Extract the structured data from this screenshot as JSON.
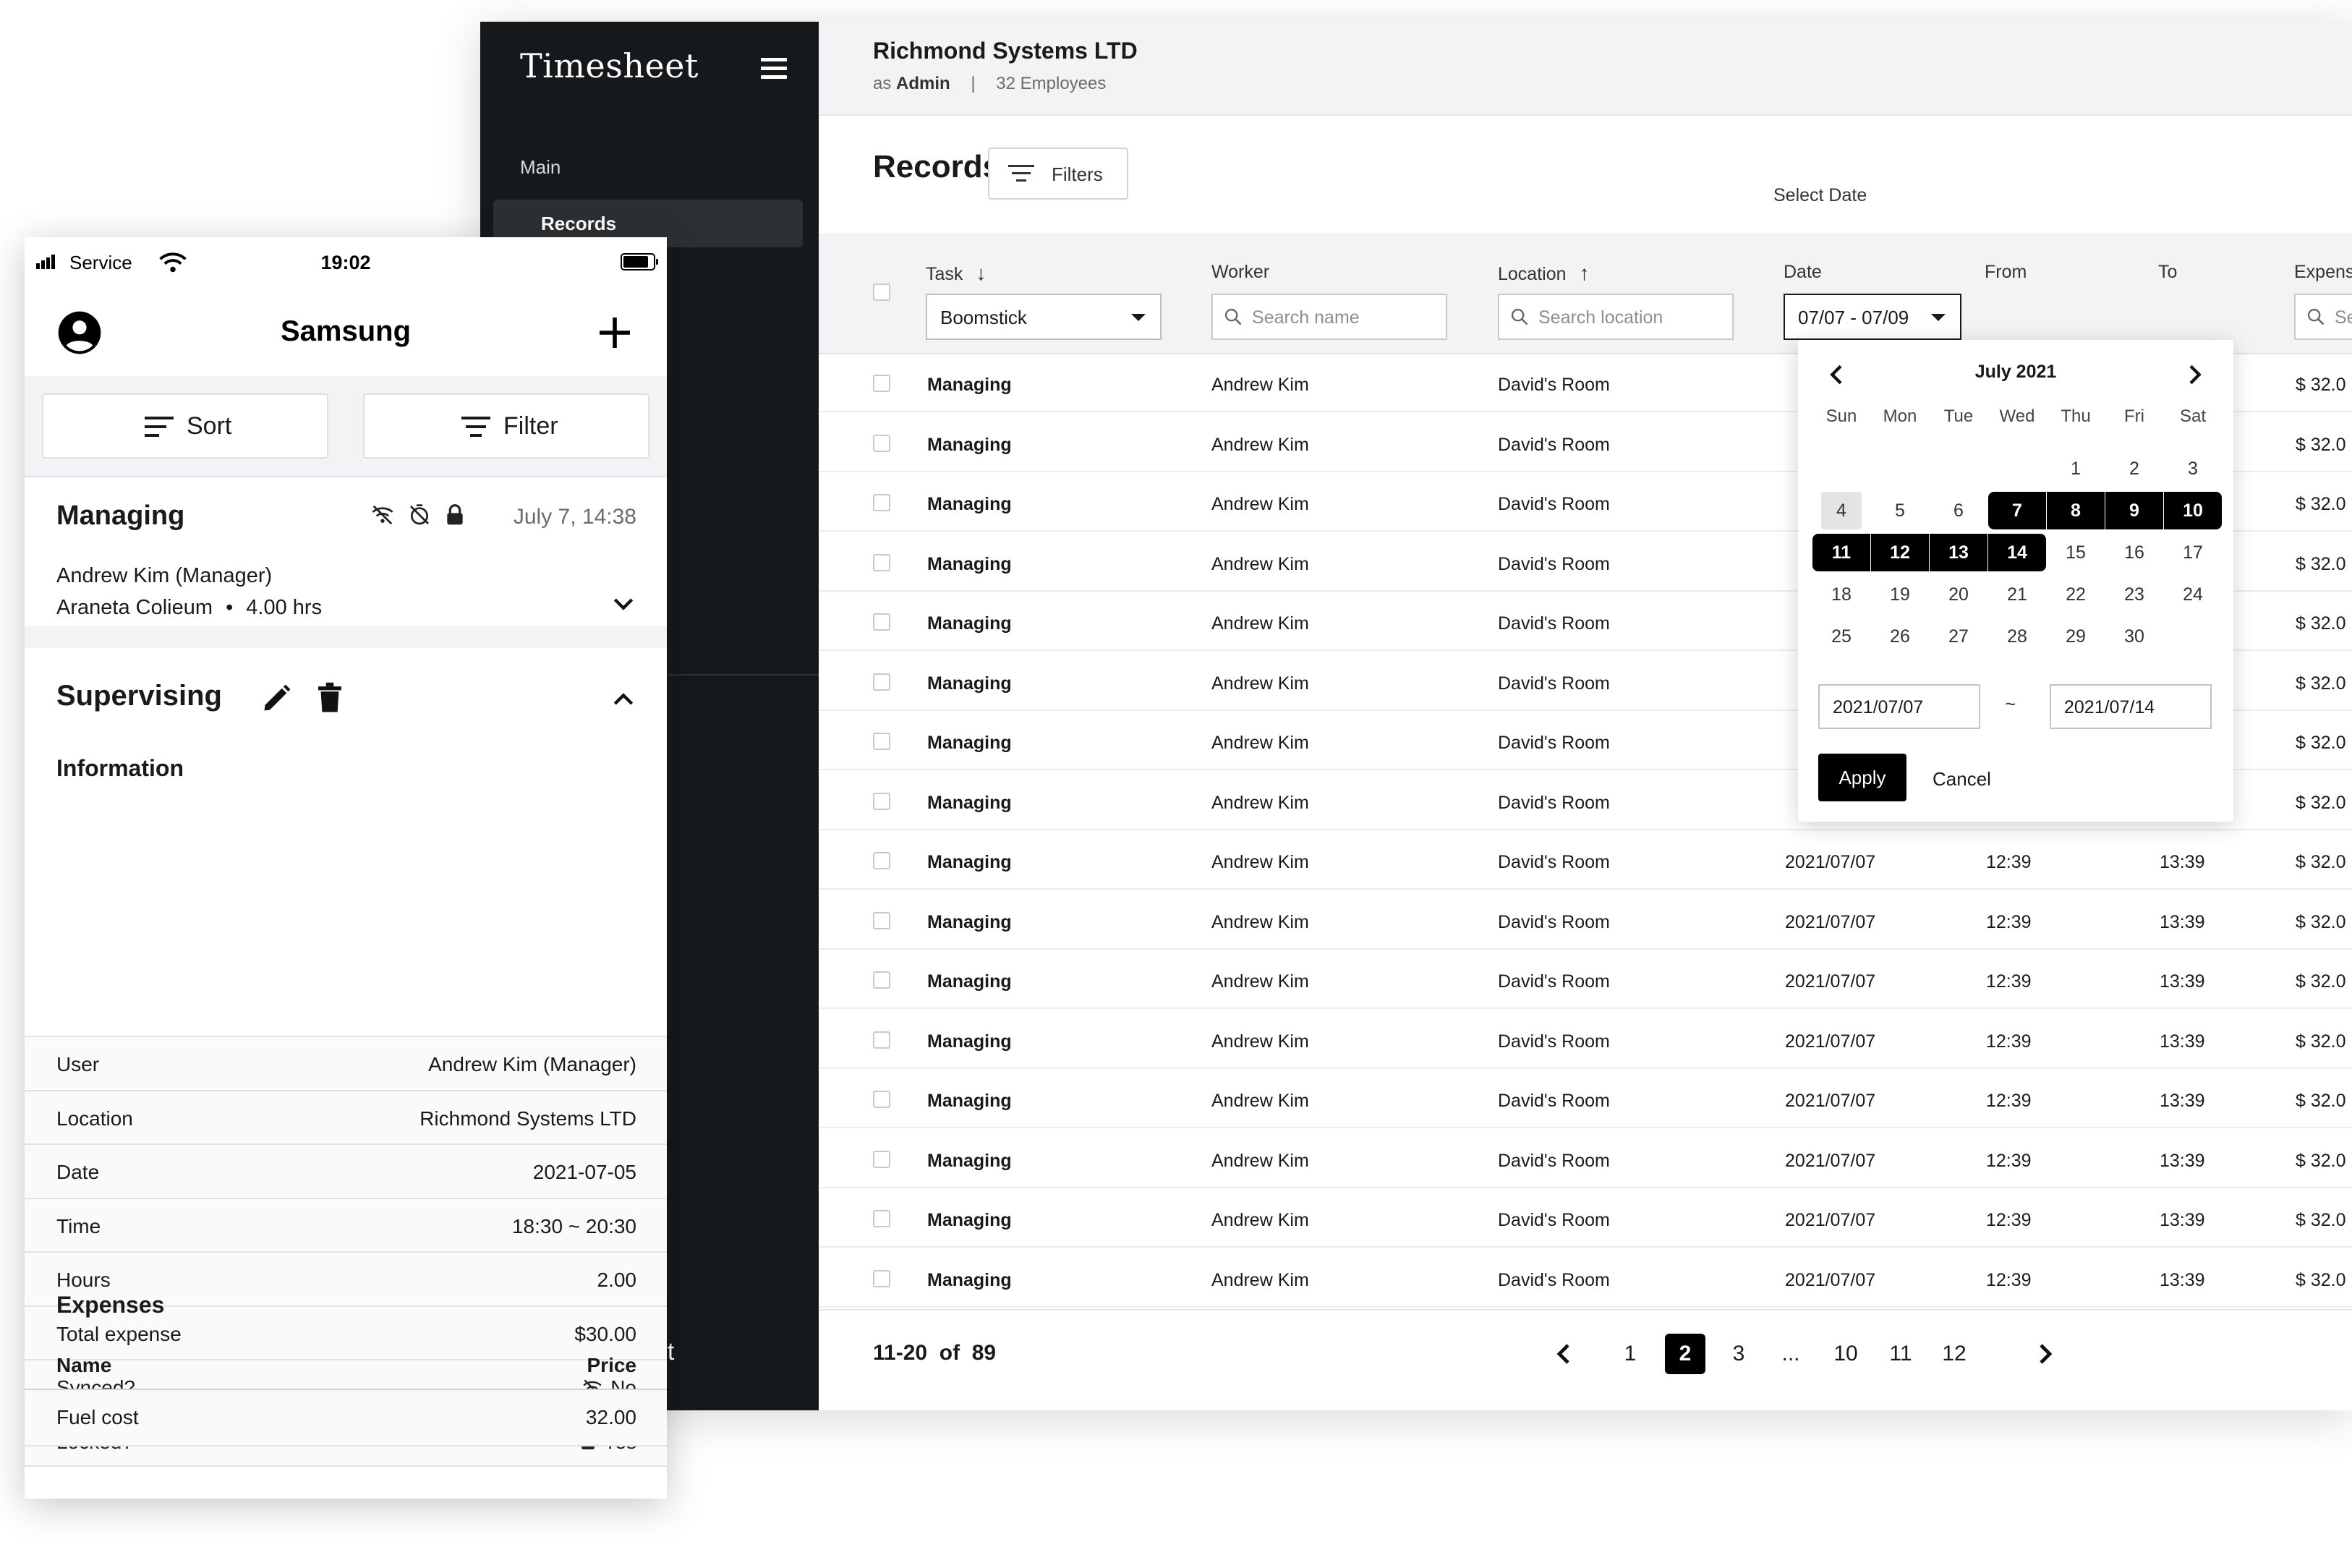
{
  "desktop": {
    "sidebar": {
      "brand": "Timesheet",
      "section_label": "Main",
      "active_item": "Records",
      "logout_partial": "ut"
    },
    "topbar": {
      "company": "Richmond Systems LTD",
      "role_prefix": "as",
      "role": "Admin",
      "separator": "|",
      "employees": "32 Employees"
    },
    "page_title": "Records",
    "filters_label": "Filters",
    "select_date_label": "Select Date",
    "columns": {
      "task": "Task",
      "worker": "Worker",
      "location": "Location",
      "date": "Date",
      "from": "From",
      "to": "To",
      "expense": "Expens"
    },
    "filters": {
      "task_value": "Boomstick",
      "worker_placeholder": "Search name",
      "location_placeholder": "Search location",
      "date_value": "07/07 - 07/09",
      "expense_placeholder": "Se"
    },
    "rows": [
      {
        "task": "Managing",
        "worker": "Andrew Kim",
        "location": "David's Room",
        "date": "",
        "from": "",
        "to": "",
        "expense": "$ 32.0"
      },
      {
        "task": "Managing",
        "worker": "Andrew Kim",
        "location": "David's Room",
        "date": "",
        "from": "",
        "to": "",
        "expense": "$ 32.0"
      },
      {
        "task": "Managing",
        "worker": "Andrew Kim",
        "location": "David's Room",
        "date": "",
        "from": "",
        "to": "",
        "expense": "$ 32.0"
      },
      {
        "task": "Managing",
        "worker": "Andrew Kim",
        "location": "David's Room",
        "date": "",
        "from": "",
        "to": "",
        "expense": "$ 32.0"
      },
      {
        "task": "Managing",
        "worker": "Andrew Kim",
        "location": "David's Room",
        "date": "",
        "from": "",
        "to": "",
        "expense": "$ 32.0"
      },
      {
        "task": "Managing",
        "worker": "Andrew Kim",
        "location": "David's Room",
        "date": "",
        "from": "",
        "to": "",
        "expense": "$ 32.0"
      },
      {
        "task": "Managing",
        "worker": "Andrew Kim",
        "location": "David's Room",
        "date": "",
        "from": "",
        "to": "",
        "expense": "$ 32.0"
      },
      {
        "task": "Managing",
        "worker": "Andrew Kim",
        "location": "David's Room",
        "date": "",
        "from": "",
        "to": "",
        "expense": "$ 32.0"
      },
      {
        "task": "Managing",
        "worker": "Andrew Kim",
        "location": "David's Room",
        "date": "2021/07/07",
        "from": "12:39",
        "to": "13:39",
        "expense": "$ 32.0"
      },
      {
        "task": "Managing",
        "worker": "Andrew Kim",
        "location": "David's Room",
        "date": "2021/07/07",
        "from": "12:39",
        "to": "13:39",
        "expense": "$ 32.0"
      },
      {
        "task": "Managing",
        "worker": "Andrew Kim",
        "location": "David's Room",
        "date": "2021/07/07",
        "from": "12:39",
        "to": "13:39",
        "expense": "$ 32.0"
      },
      {
        "task": "Managing",
        "worker": "Andrew Kim",
        "location": "David's Room",
        "date": "2021/07/07",
        "from": "12:39",
        "to": "13:39",
        "expense": "$ 32.0"
      },
      {
        "task": "Managing",
        "worker": "Andrew Kim",
        "location": "David's Room",
        "date": "2021/07/07",
        "from": "12:39",
        "to": "13:39",
        "expense": "$ 32.0"
      },
      {
        "task": "Managing",
        "worker": "Andrew Kim",
        "location": "David's Room",
        "date": "2021/07/07",
        "from": "12:39",
        "to": "13:39",
        "expense": "$ 32.0"
      },
      {
        "task": "Managing",
        "worker": "Andrew Kim",
        "location": "David's Room",
        "date": "2021/07/07",
        "from": "12:39",
        "to": "13:39",
        "expense": "$ 32.0"
      },
      {
        "task": "Managing",
        "worker": "Andrew Kim",
        "location": "David's Room",
        "date": "2021/07/07",
        "from": "12:39",
        "to": "13:39",
        "expense": "$ 32.0"
      }
    ],
    "datepicker": {
      "month": "July 2021",
      "weekdays": [
        "Sun",
        "Mon",
        "Tue",
        "Wed",
        "Thu",
        "Fri",
        "Sat"
      ],
      "days": [
        [
          "",
          "",
          "",
          "",
          "1",
          "2",
          "3"
        ],
        [
          "4",
          "5",
          "6",
          "7",
          "8",
          "9",
          "10"
        ],
        [
          "11",
          "12",
          "13",
          "14",
          "15",
          "16",
          "17"
        ],
        [
          "18",
          "19",
          "20",
          "21",
          "22",
          "23",
          "24"
        ],
        [
          "25",
          "26",
          "27",
          "28",
          "29",
          "30",
          ""
        ]
      ],
      "today": "4",
      "selected": [
        "7",
        "8",
        "9",
        "10",
        "11",
        "12",
        "13",
        "14"
      ],
      "start": "2021/07/07",
      "tilde": "~",
      "end": "2021/07/14",
      "apply": "Apply",
      "cancel": "Cancel"
    },
    "pagination": {
      "range": "11-20",
      "of": "of",
      "total": "89",
      "pages": [
        "1",
        "2",
        "3",
        "...",
        "10",
        "11",
        "12"
      ],
      "active": "2"
    }
  },
  "mobile": {
    "status": {
      "carrier": "Service",
      "time": "19:02"
    },
    "title": "Samsung",
    "sort_label": "Sort",
    "filter_label": "Filter",
    "card1": {
      "title": "Managing",
      "date": "July 7,  14:38",
      "worker": "Andrew Kim  (Manager)",
      "location": "Araneta Colieum",
      "bullet": "•",
      "hours": "4.00 hrs"
    },
    "card2": {
      "title": "Supervising",
      "info_title": "Information",
      "fields": [
        {
          "k": "User",
          "v": "Andrew Kim (Manager)"
        },
        {
          "k": "Location",
          "v": "Richmond Systems LTD"
        },
        {
          "k": "Date",
          "v": "2021-07-05"
        },
        {
          "k": "Time",
          "v": "18:30 ~ 20:30"
        },
        {
          "k": "Hours",
          "v": "2.00"
        },
        {
          "k": "Total expense",
          "v": "$30.00"
        },
        {
          "k": "Synced?",
          "v": "No"
        },
        {
          "k": "Locked?",
          "v": "Yes"
        }
      ],
      "expenses_title": "Expenses",
      "exp_name_col": "Name",
      "exp_price_col": "Price",
      "expenses": [
        {
          "name": "Fuel cost",
          "price": "32.00"
        }
      ]
    }
  }
}
